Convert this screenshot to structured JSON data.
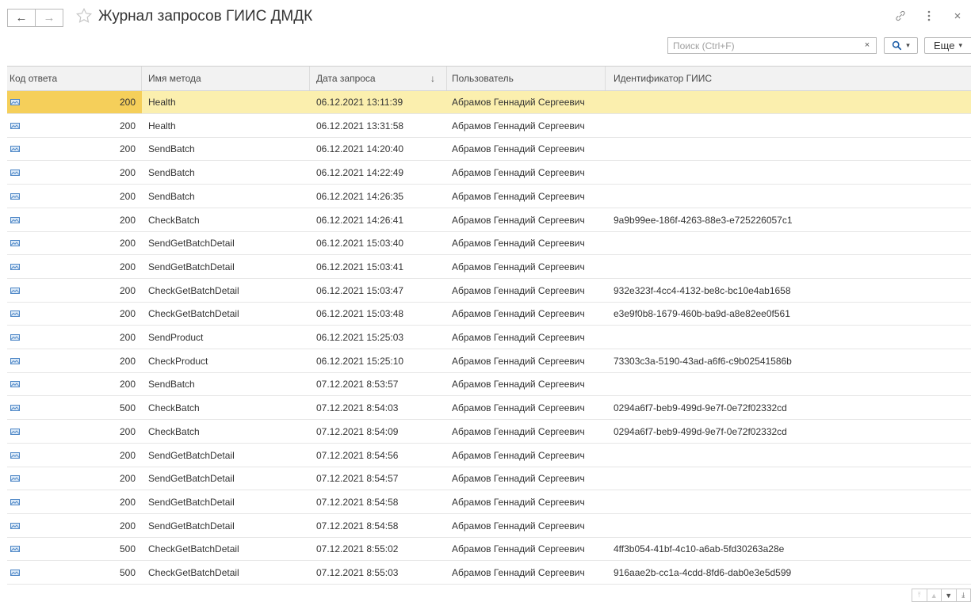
{
  "window": {
    "title": "Журнал запросов ГИИС ДМДК"
  },
  "toolbar": {
    "search_placeholder": "Поиск (Ctrl+F)",
    "clear_label": "×",
    "more_label": "Еще"
  },
  "icons": {
    "back": "arrow-left-icon",
    "forward": "arrow-right-icon",
    "favorite": "star-icon",
    "link": "link-icon",
    "menu": "kebab-menu-icon",
    "close": "close-icon",
    "search": "search-icon",
    "row": "envelope-icon"
  },
  "colors": {
    "selected_row": "#fbefae",
    "selected_cell": "#f5cf5a"
  },
  "table": {
    "columns": [
      "Код ответа",
      "Имя метода",
      "Дата запроса",
      "Пользователь",
      "Идентификатор ГИИС"
    ],
    "sort_indicator": "↓",
    "rows": [
      {
        "code": "200",
        "method": "Health",
        "date": "06.12.2021 13:11:39",
        "user": "Абрамов Геннадий Сергеевич",
        "giis_id": ""
      },
      {
        "code": "200",
        "method": "Health",
        "date": "06.12.2021 13:31:58",
        "user": "Абрамов Геннадий Сергеевич",
        "giis_id": ""
      },
      {
        "code": "200",
        "method": "SendBatch",
        "date": "06.12.2021 14:20:40",
        "user": "Абрамов Геннадий Сергеевич",
        "giis_id": ""
      },
      {
        "code": "200",
        "method": "SendBatch",
        "date": "06.12.2021 14:22:49",
        "user": "Абрамов Геннадий Сергеевич",
        "giis_id": ""
      },
      {
        "code": "200",
        "method": "SendBatch",
        "date": "06.12.2021 14:26:35",
        "user": "Абрамов Геннадий Сергеевич",
        "giis_id": ""
      },
      {
        "code": "200",
        "method": "CheckBatch",
        "date": "06.12.2021 14:26:41",
        "user": "Абрамов Геннадий Сергеевич",
        "giis_id": "9a9b99ee-186f-4263-88e3-e725226057c1"
      },
      {
        "code": "200",
        "method": "SendGetBatchDetail",
        "date": "06.12.2021 15:03:40",
        "user": "Абрамов Геннадий Сергеевич",
        "giis_id": ""
      },
      {
        "code": "200",
        "method": "SendGetBatchDetail",
        "date": "06.12.2021 15:03:41",
        "user": "Абрамов Геннадий Сергеевич",
        "giis_id": ""
      },
      {
        "code": "200",
        "method": "CheckGetBatchDetail",
        "date": "06.12.2021 15:03:47",
        "user": "Абрамов Геннадий Сергеевич",
        "giis_id": "932e323f-4cc4-4132-be8c-bc10e4ab1658"
      },
      {
        "code": "200",
        "method": "CheckGetBatchDetail",
        "date": "06.12.2021 15:03:48",
        "user": "Абрамов Геннадий Сергеевич",
        "giis_id": "e3e9f0b8-1679-460b-ba9d-a8e82ee0f561"
      },
      {
        "code": "200",
        "method": "SendProduct",
        "date": "06.12.2021 15:25:03",
        "user": "Абрамов Геннадий Сергеевич",
        "giis_id": ""
      },
      {
        "code": "200",
        "method": "CheckProduct",
        "date": "06.12.2021 15:25:10",
        "user": "Абрамов Геннадий Сергеевич",
        "giis_id": "73303c3a-5190-43ad-a6f6-c9b02541586b"
      },
      {
        "code": "200",
        "method": "SendBatch",
        "date": "07.12.2021 8:53:57",
        "user": "Абрамов Геннадий Сергеевич",
        "giis_id": ""
      },
      {
        "code": "500",
        "method": "CheckBatch",
        "date": "07.12.2021 8:54:03",
        "user": "Абрамов Геннадий Сергеевич",
        "giis_id": "0294a6f7-beb9-499d-9e7f-0e72f02332cd"
      },
      {
        "code": "200",
        "method": "CheckBatch",
        "date": "07.12.2021 8:54:09",
        "user": "Абрамов Геннадий Сергеевич",
        "giis_id": "0294a6f7-beb9-499d-9e7f-0e72f02332cd"
      },
      {
        "code": "200",
        "method": "SendGetBatchDetail",
        "date": "07.12.2021 8:54:56",
        "user": "Абрамов Геннадий Сергеевич",
        "giis_id": ""
      },
      {
        "code": "200",
        "method": "SendGetBatchDetail",
        "date": "07.12.2021 8:54:57",
        "user": "Абрамов Геннадий Сергеевич",
        "giis_id": ""
      },
      {
        "code": "200",
        "method": "SendGetBatchDetail",
        "date": "07.12.2021 8:54:58",
        "user": "Абрамов Геннадий Сергеевич",
        "giis_id": ""
      },
      {
        "code": "200",
        "method": "SendGetBatchDetail",
        "date": "07.12.2021 8:54:58",
        "user": "Абрамов Геннадий Сергеевич",
        "giis_id": ""
      },
      {
        "code": "500",
        "method": "CheckGetBatchDetail",
        "date": "07.12.2021 8:55:02",
        "user": "Абрамов Геннадий Сергеевич",
        "giis_id": "4ff3b054-41bf-4c10-a6ab-5fd30263a28e"
      },
      {
        "code": "500",
        "method": "CheckGetBatchDetail",
        "date": "07.12.2021 8:55:03",
        "user": "Абрамов Геннадий Сергеевич",
        "giis_id": "916aae2b-cc1a-4cdd-8fd6-dab0e3e5d599"
      }
    ]
  }
}
